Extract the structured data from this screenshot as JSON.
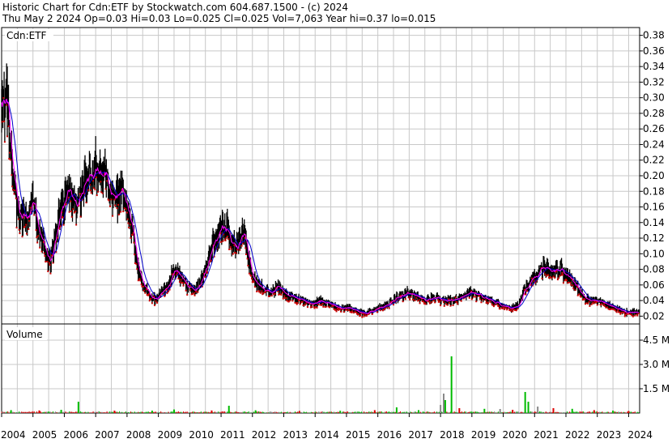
{
  "header": {
    "line1": "Historic Chart for Cdn:ETF by Stockwatch.com 604.687.1500 - (c) 2024",
    "line2": "Thu May  2 2024  Op=0.03  Hi=0.03  Lo=0.025  Cl=0.025  Vol=7,063  Year hi=0.37  lo=0.015"
  },
  "colors": {
    "background": "#ffffff",
    "grid": "#c8c8c8",
    "price_bar": "#000000",
    "down_marker": "#cc0000",
    "ma_short": "#ff00ff",
    "ma_long": "#0000cc",
    "volume_up": "#00bb00",
    "volume_down": "#dd0000",
    "volume_flat": "#888888"
  },
  "chart_data": [
    {
      "type": "bar",
      "panel": "price",
      "title": "Cdn:ETF",
      "ylim": [
        0.01,
        0.39
      ],
      "y_ticks": [
        0.02,
        0.04,
        0.06,
        0.08,
        0.1,
        0.12,
        0.14,
        0.16,
        0.18,
        0.2,
        0.22,
        0.24,
        0.26,
        0.28,
        0.3,
        0.32,
        0.34,
        0.36,
        0.38
      ],
      "y_tick_labels": [
        "0.02",
        "0.04",
        "0.06",
        "0.08",
        "0.10",
        "0.12",
        "0.14",
        "0.16",
        "0.18",
        "0.20",
        "0.22",
        "0.24",
        "0.26",
        "0.28",
        "0.30",
        "0.32",
        "0.34",
        "0.36",
        "0.38"
      ],
      "x_labels": [
        "2004",
        "2005",
        "2006",
        "2007",
        "2008",
        "2009",
        "2010",
        "2011",
        "2012",
        "2013",
        "2014",
        "2015",
        "2016",
        "2017",
        "2018",
        "2019",
        "2020",
        "2021",
        "2022",
        "2023",
        "2024"
      ],
      "xlim": [
        2004.0,
        2024.35
      ],
      "grid": true,
      "price_path": [
        [
          2004.0,
          0.27
        ],
        [
          2004.1,
          0.3
        ],
        [
          2004.2,
          0.28
        ],
        [
          2004.3,
          0.23
        ],
        [
          2004.45,
          0.17
        ],
        [
          2004.6,
          0.15
        ],
        [
          2004.8,
          0.14
        ],
        [
          2005.0,
          0.17
        ],
        [
          2005.2,
          0.13
        ],
        [
          2005.4,
          0.1
        ],
        [
          2005.55,
          0.09
        ],
        [
          2005.7,
          0.12
        ],
        [
          2005.85,
          0.15
        ],
        [
          2006.0,
          0.17
        ],
        [
          2006.2,
          0.18
        ],
        [
          2006.4,
          0.16
        ],
        [
          2006.6,
          0.19
        ],
        [
          2006.8,
          0.2
        ],
        [
          2007.0,
          0.21
        ],
        [
          2007.2,
          0.2
        ],
        [
          2007.4,
          0.19
        ],
        [
          2007.6,
          0.17
        ],
        [
          2007.8,
          0.18
        ],
        [
          2008.0,
          0.16
        ],
        [
          2008.2,
          0.12
        ],
        [
          2008.35,
          0.08
        ],
        [
          2008.5,
          0.06
        ],
        [
          2008.7,
          0.05
        ],
        [
          2008.9,
          0.04
        ],
        [
          2009.1,
          0.05
        ],
        [
          2009.3,
          0.06
        ],
        [
          2009.5,
          0.08
        ],
        [
          2009.7,
          0.07
        ],
        [
          2009.9,
          0.06
        ],
        [
          2010.1,
          0.05
        ],
        [
          2010.3,
          0.06
        ],
        [
          2010.5,
          0.08
        ],
        [
          2010.7,
          0.11
        ],
        [
          2010.9,
          0.13
        ],
        [
          2011.1,
          0.14
        ],
        [
          2011.3,
          0.12
        ],
        [
          2011.5,
          0.11
        ],
        [
          2011.7,
          0.13
        ],
        [
          2011.85,
          0.1
        ],
        [
          2012.0,
          0.07
        ],
        [
          2012.2,
          0.06
        ],
        [
          2012.4,
          0.055
        ],
        [
          2012.6,
          0.05
        ],
        [
          2012.8,
          0.06
        ],
        [
          2013.0,
          0.05
        ],
        [
          2013.3,
          0.045
        ],
        [
          2013.6,
          0.04
        ],
        [
          2013.9,
          0.035
        ],
        [
          2014.2,
          0.04
        ],
        [
          2014.5,
          0.035
        ],
        [
          2014.8,
          0.03
        ],
        [
          2015.1,
          0.03
        ],
        [
          2015.4,
          0.025
        ],
        [
          2015.7,
          0.025
        ],
        [
          2016.0,
          0.03
        ],
        [
          2016.3,
          0.035
        ],
        [
          2016.6,
          0.045
        ],
        [
          2016.9,
          0.05
        ],
        [
          2017.2,
          0.045
        ],
        [
          2017.5,
          0.04
        ],
        [
          2017.8,
          0.045
        ],
        [
          2018.1,
          0.04
        ],
        [
          2018.4,
          0.04
        ],
        [
          2018.7,
          0.045
        ],
        [
          2019.0,
          0.05
        ],
        [
          2019.3,
          0.045
        ],
        [
          2019.6,
          0.04
        ],
        [
          2019.9,
          0.035
        ],
        [
          2020.2,
          0.03
        ],
        [
          2020.5,
          0.035
        ],
        [
          2020.75,
          0.06
        ],
        [
          2021.0,
          0.07
        ],
        [
          2021.2,
          0.08
        ],
        [
          2021.4,
          0.085
        ],
        [
          2021.6,
          0.075
        ],
        [
          2021.8,
          0.08
        ],
        [
          2022.0,
          0.075
        ],
        [
          2022.2,
          0.065
        ],
        [
          2022.4,
          0.055
        ],
        [
          2022.6,
          0.045
        ],
        [
          2022.8,
          0.04
        ],
        [
          2023.0,
          0.04
        ],
        [
          2023.3,
          0.035
        ],
        [
          2023.6,
          0.03
        ],
        [
          2023.9,
          0.025
        ],
        [
          2024.1,
          0.025
        ],
        [
          2024.33,
          0.025
        ]
      ],
      "series": [
        {
          "values_ref": "price_path"
        }
      ]
    },
    {
      "type": "bar",
      "panel": "volume",
      "title": "Volume",
      "ylim": [
        0,
        5500000
      ],
      "y_ticks": [
        1500000,
        3000000,
        4500000
      ],
      "y_tick_labels": [
        "1.5 M",
        "3.0 M",
        "4.5 M"
      ],
      "spikes": [
        [
          2004.3,
          180000,
          "up"
        ],
        [
          2005.2,
          160000,
          "down"
        ],
        [
          2005.9,
          200000,
          "up"
        ],
        [
          2006.45,
          700000,
          "up"
        ],
        [
          2007.6,
          150000,
          "down"
        ],
        [
          2008.8,
          150000,
          "up"
        ],
        [
          2009.5,
          220000,
          "up"
        ],
        [
          2010.7,
          160000,
          "down"
        ],
        [
          2011.25,
          450000,
          "up"
        ],
        [
          2012.1,
          170000,
          "up"
        ],
        [
          2013.5,
          130000,
          "down"
        ],
        [
          2014.8,
          140000,
          "up"
        ],
        [
          2015.9,
          180000,
          "down"
        ],
        [
          2016.6,
          350000,
          "up"
        ],
        [
          2017.3,
          180000,
          "up"
        ],
        [
          2018.0,
          500000,
          "flat"
        ],
        [
          2018.1,
          1200000,
          "flat"
        ],
        [
          2018.15,
          800000,
          "up"
        ],
        [
          2018.35,
          3500000,
          "up"
        ],
        [
          2018.6,
          300000,
          "down"
        ],
        [
          2019.4,
          260000,
          "up"
        ],
        [
          2019.9,
          250000,
          "flat"
        ],
        [
          2020.3,
          200000,
          "down"
        ],
        [
          2020.7,
          1300000,
          "up"
        ],
        [
          2020.8,
          700000,
          "up"
        ],
        [
          2021.1,
          400000,
          "flat"
        ],
        [
          2021.6,
          300000,
          "down"
        ],
        [
          2022.2,
          260000,
          "up"
        ],
        [
          2022.9,
          180000,
          "down"
        ],
        [
          2023.5,
          150000,
          "up"
        ],
        [
          2024.0,
          130000,
          "down"
        ]
      ]
    }
  ]
}
